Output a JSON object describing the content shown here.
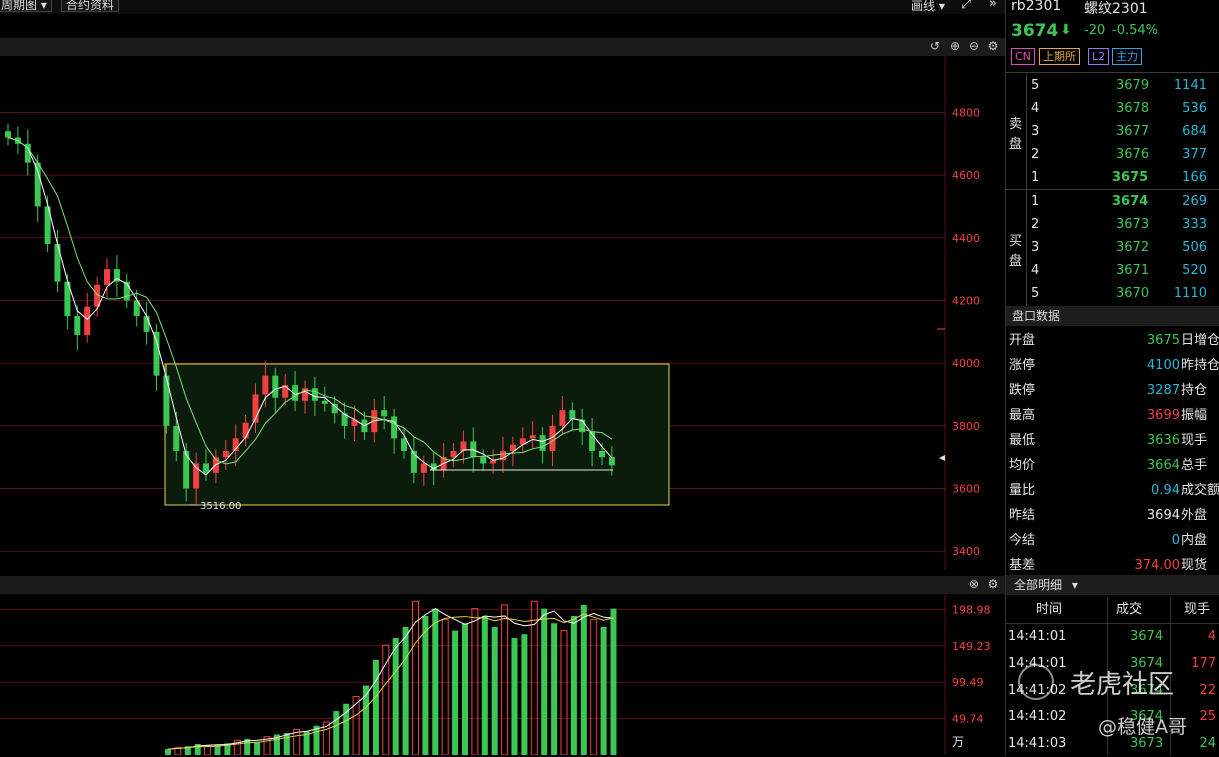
{
  "toolbar": {
    "period_label": "周期图",
    "contract_info_label": "合约资料",
    "draw_label": "画线"
  },
  "chart": {
    "price_ticks": [
      "4800",
      "4600",
      "4400",
      "4200",
      "4000",
      "3800",
      "3600",
      "3400"
    ],
    "low_annotation": "3516.00",
    "volume_ticks": [
      "198.98",
      "149.23",
      "99.49",
      "49.74"
    ],
    "volume_unit": "万"
  },
  "chart_data": [
    {
      "type": "candlestick",
      "title": "",
      "ylim": [
        3340,
        4980
      ],
      "ma_lines": 2,
      "closes_approx": [
        4720,
        4700,
        4640,
        4500,
        4380,
        4260,
        4150,
        4090,
        4180,
        4250,
        4300,
        4260,
        4200,
        4150,
        4100,
        3960,
        3800,
        3720,
        3600,
        3680,
        3650,
        3700,
        3720,
        3760,
        3810,
        3900,
        3960,
        3890,
        3930,
        3880,
        3920,
        3880,
        3870,
        3840,
        3800,
        3820,
        3780,
        3850,
        3830,
        3760,
        3720,
        3650,
        3680,
        3660,
        3700,
        3720,
        3750,
        3700,
        3680,
        3690,
        3720,
        3740,
        3760,
        3770,
        3720,
        3800,
        3850,
        3820,
        3780,
        3720,
        3700,
        3674
      ]
    },
    {
      "type": "bar",
      "title": "",
      "ylim": [
        0,
        220
      ],
      "values_approx": [
        8,
        10,
        12,
        15,
        13,
        14,
        16,
        20,
        22,
        18,
        25,
        28,
        30,
        35,
        32,
        40,
        45,
        60,
        70,
        80,
        95,
        130,
        150,
        160,
        175,
        210,
        190,
        200,
        185,
        170,
        180,
        200,
        190,
        175,
        205,
        160,
        165,
        210,
        200,
        180,
        170,
        190,
        205,
        185,
        175,
        200
      ]
    }
  ],
  "quote": {
    "code": "rb2301",
    "name": "螺纹2301",
    "last": "3674",
    "arrow": "⬇",
    "change": "-20",
    "change_pct": "-0.54%",
    "tags": [
      "CN",
      "上期所",
      "L2",
      "主力"
    ]
  },
  "orderbook": {
    "sell_label_1": "卖",
    "sell_label_2": "盘",
    "buy_label_1": "买",
    "buy_label_2": "盘",
    "asks": [
      {
        "level": "5",
        "price": "3679",
        "vol": "1141"
      },
      {
        "level": "4",
        "price": "3678",
        "vol": "536"
      },
      {
        "level": "3",
        "price": "3677",
        "vol": "684"
      },
      {
        "level": "2",
        "price": "3676",
        "vol": "377"
      },
      {
        "level": "1",
        "price": "3675",
        "vol": "166"
      }
    ],
    "bids": [
      {
        "level": "1",
        "price": "3674",
        "vol": "269"
      },
      {
        "level": "2",
        "price": "3673",
        "vol": "333"
      },
      {
        "level": "3",
        "price": "3672",
        "vol": "506"
      },
      {
        "level": "4",
        "price": "3671",
        "vol": "520"
      },
      {
        "level": "5",
        "price": "3670",
        "vol": "1110"
      }
    ]
  },
  "pankou": {
    "title": "盘口数据",
    "rows": [
      {
        "label": "开盘",
        "value": "3675",
        "right": "日增仓"
      },
      {
        "label": "涨停",
        "value": "4100",
        "right": "昨持仓"
      },
      {
        "label": "跌停",
        "value": "3287",
        "right": "持仓"
      },
      {
        "label": "最高",
        "value": "3699",
        "right": "振幅"
      },
      {
        "label": "最低",
        "value": "3636",
        "right": "现手"
      },
      {
        "label": "均价",
        "value": "3664",
        "right": "总手"
      },
      {
        "label": "量比",
        "value": "0.94",
        "right": "成交额"
      },
      {
        "label": "昨结",
        "value": "3694",
        "right": "外盘"
      },
      {
        "label": "今结",
        "value": "0",
        "right": "内盘"
      },
      {
        "label": "基差",
        "value": "374.00",
        "right": "现货"
      }
    ]
  },
  "trades": {
    "title": "全部明细",
    "headers": [
      "时间",
      "成交",
      "现手"
    ],
    "rows": [
      {
        "time": "14:41:01",
        "price": "3674",
        "vol": "4"
      },
      {
        "time": "14:41:01",
        "price": "3674",
        "vol": "177"
      },
      {
        "time": "14:41:02",
        "price": "3674",
        "vol": "22"
      },
      {
        "time": "14:41:02",
        "price": "3674",
        "vol": "25"
      },
      {
        "time": "14:41:03",
        "price": "3673",
        "vol": "24"
      }
    ]
  },
  "watermark": {
    "brand": "老虎社区",
    "author": "@稳健A哥"
  },
  "colors": {
    "up": "#f24040",
    "down": "#3cc755",
    "range_box": "#e3d24a",
    "grid": "#5a1212"
  }
}
